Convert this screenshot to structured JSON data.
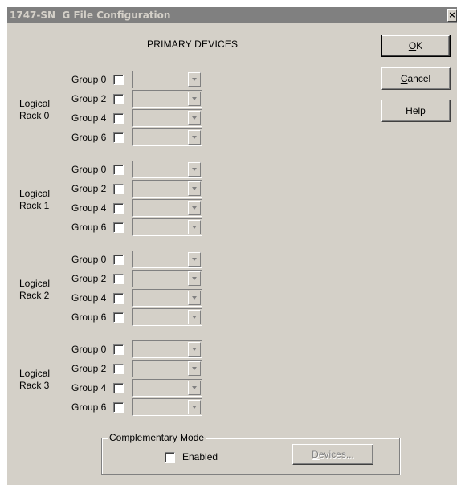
{
  "window": {
    "title": "1747-SN  G File Configuration",
    "close_glyph": "×"
  },
  "heading": "PRIMARY DEVICES",
  "buttons": {
    "ok": {
      "mnemonic": "O",
      "rest": "K"
    },
    "cancel": {
      "mnemonic": "C",
      "rest": "ancel"
    },
    "help": "Help",
    "devices": {
      "mnemonic": "D",
      "rest": "evices..."
    }
  },
  "racks": [
    {
      "label_line1": "Logical",
      "label_line2": "Rack 0",
      "groups": [
        {
          "label": "Group 0",
          "checked": false,
          "value": ""
        },
        {
          "label": "Group 2",
          "checked": false,
          "value": ""
        },
        {
          "label": "Group 4",
          "checked": false,
          "value": ""
        },
        {
          "label": "Group 6",
          "checked": false,
          "value": ""
        }
      ]
    },
    {
      "label_line1": "Logical",
      "label_line2": "Rack 1",
      "groups": [
        {
          "label": "Group 0",
          "checked": false,
          "value": ""
        },
        {
          "label": "Group 2",
          "checked": false,
          "value": ""
        },
        {
          "label": "Group 4",
          "checked": false,
          "value": ""
        },
        {
          "label": "Group 6",
          "checked": false,
          "value": ""
        }
      ]
    },
    {
      "label_line1": "Logical",
      "label_line2": "Rack 2",
      "groups": [
        {
          "label": "Group 0",
          "checked": false,
          "value": ""
        },
        {
          "label": "Group 2",
          "checked": false,
          "value": ""
        },
        {
          "label": "Group 4",
          "checked": false,
          "value": ""
        },
        {
          "label": "Group 6",
          "checked": false,
          "value": ""
        }
      ]
    },
    {
      "label_line1": "Logical",
      "label_line2": "Rack 3",
      "groups": [
        {
          "label": "Group 0",
          "checked": false,
          "value": ""
        },
        {
          "label": "Group 2",
          "checked": false,
          "value": ""
        },
        {
          "label": "Group 4",
          "checked": false,
          "value": ""
        },
        {
          "label": "Group 6",
          "checked": false,
          "value": ""
        }
      ]
    }
  ],
  "complementary": {
    "legend": "Complementary Mode",
    "enabled_label": "Enabled",
    "enabled_checked": false
  },
  "colors": {
    "face": "#d4d0c8",
    "titlebar_inactive": "#808080",
    "disabled_text": "#808080"
  },
  "icons": {
    "dropdown": "chevron-down-icon",
    "close": "close-icon"
  }
}
